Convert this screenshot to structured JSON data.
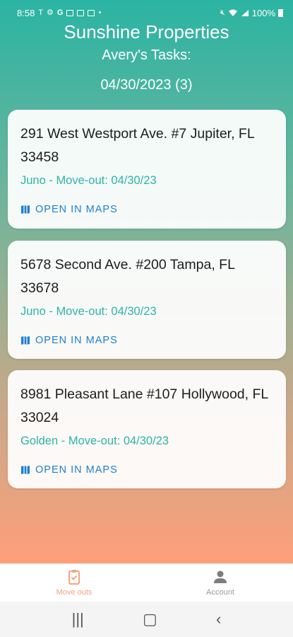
{
  "status_bar": {
    "time": "8:58",
    "battery": "100%",
    "icons_left": [
      "carrier-t-icon",
      "settings-icon",
      "google-icon",
      "gallery-icon",
      "gallery-icon",
      "gallery-icon",
      "dot-icon"
    ],
    "icons_right": [
      "mute-icon",
      "wifi-icon",
      "signal-icon",
      "battery-icon"
    ]
  },
  "header": {
    "app_title": "Sunshine Properties",
    "subtitle": "Avery's Tasks:",
    "date_count": "04/30/2023 (3)"
  },
  "tasks": [
    {
      "address": "291 West Westport Ave. #7 Jupiter, FL 33458",
      "detail": "Juno - Move-out: 04/30/23",
      "action": "OPEN IN MAPS"
    },
    {
      "address": "5678 Second Ave. #200 Tampa, FL 33678",
      "detail": "Juno - Move-out: 04/30/23",
      "action": "OPEN IN MAPS"
    },
    {
      "address": "8981 Pleasant Lane #107 Hollywood, FL 33024",
      "detail": "Golden - Move-out: 04/30/23",
      "action": "OPEN IN MAPS"
    }
  ],
  "bottom_nav": {
    "items": [
      {
        "label": "Move outs",
        "icon": "clipboard-check-icon",
        "active": true
      },
      {
        "label": "Account",
        "icon": "person-icon",
        "active": false
      }
    ]
  },
  "colors": {
    "gradient_top": "#2bb4a3",
    "gradient_bottom": "#ff9f7a",
    "accent_teal": "#2cb5a7",
    "link_blue": "#1e7fd0",
    "active_nav": "#f4a47f"
  }
}
